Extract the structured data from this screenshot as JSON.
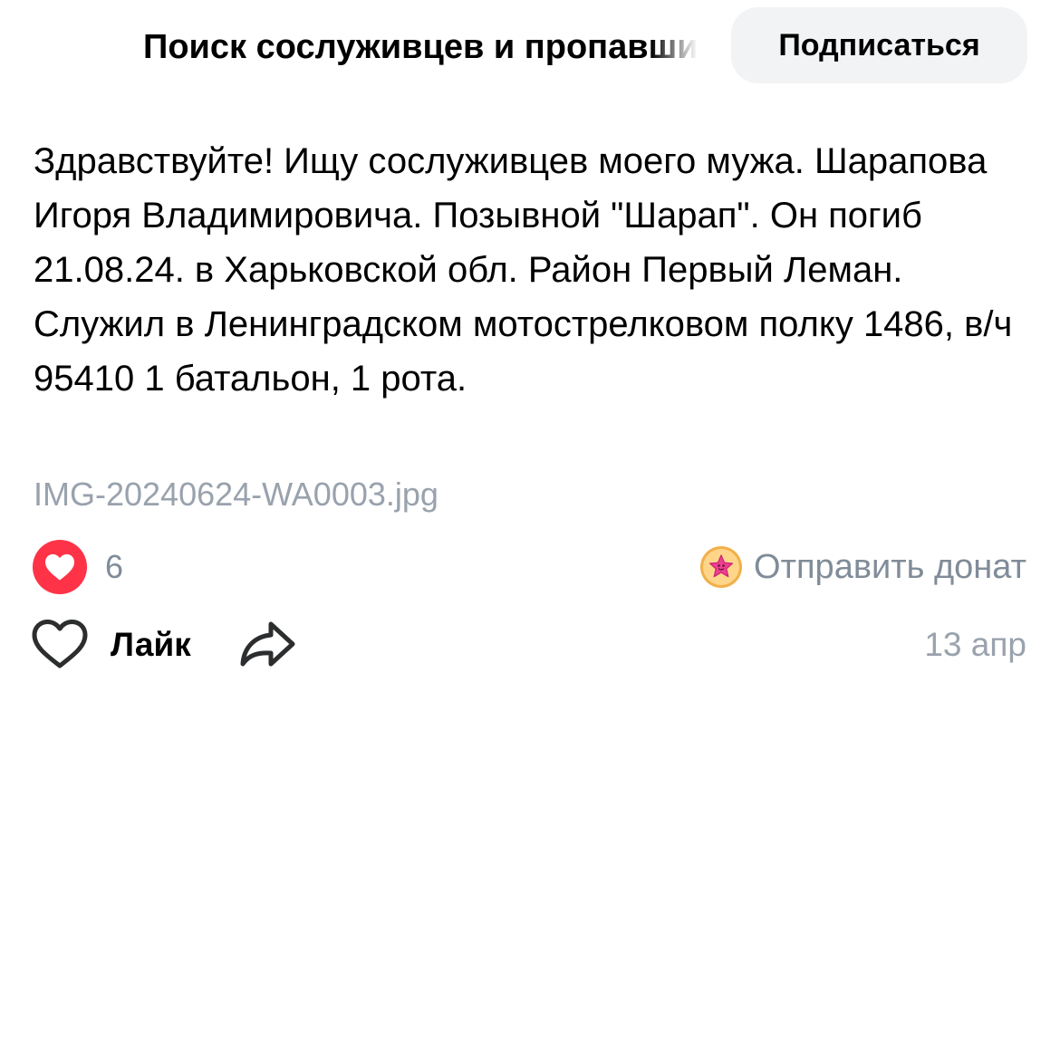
{
  "header": {
    "group_title": "Поиск сослуживцев и пропавших",
    "subscribe_label": "Подписаться"
  },
  "post": {
    "text": "Здравствуйте! Ищу сослуживцев моего мужа. Шарапова Игоря Владимировича. Позывной \"Шарап\". Он погиб 21.08.24. в Харьковской обл. Район Первый Леман. Служил в Ленинградском мотострелковом полку 1486, в/ч 95410 1 батальон, 1 рота.",
    "attachment_name": "IMG-20240624-WA0003.jpg",
    "likes_count": "6",
    "donate_label": "Отправить донат",
    "like_label": "Лайк",
    "date": "13 апр"
  },
  "icons": {
    "reaction": "heart-icon",
    "donate": "donut-icon",
    "like": "heart-outline-icon",
    "share": "share-arrow-icon"
  },
  "colors": {
    "reaction_red": "#ff3347",
    "secondary_text": "#818c99",
    "tertiary_text": "#99a2ad",
    "button_background": "#f2f3f5"
  }
}
